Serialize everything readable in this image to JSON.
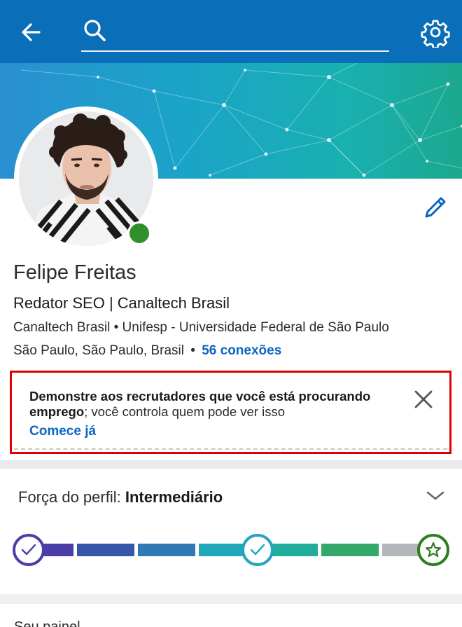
{
  "search": {
    "placeholder": "",
    "value": ""
  },
  "profile": {
    "name": "Felipe Freitas",
    "headline": "Redator SEO | Canaltech Brasil",
    "education_line": "Canaltech Brasil • Unifesp - Universidade Federal de São Paulo",
    "location": "São Paulo, São Paulo, Brasil",
    "separator": "•",
    "connections": "56 conexões",
    "presence": "online"
  },
  "job_card": {
    "bold_text": "Demonstre aos recrutadores que você está procurando emprego",
    "normal_text": "; você controla quem pode ver isso",
    "link": "Comece já"
  },
  "strength": {
    "label": "Força do perfil: ",
    "level": "Intermediário",
    "progress_steps": 2,
    "total_steps": 3
  },
  "next_section": {
    "title": "Seu painel"
  },
  "colors": {
    "topbar": "#0a6fb8",
    "link": "#0a66c2",
    "highlight_border": "#e00000",
    "presence": "#2f8f2a"
  },
  "icons": {
    "back": "arrow-left",
    "search": "magnifier",
    "settings": "gear",
    "edit": "pencil",
    "close": "x",
    "chevron": "chevron-down",
    "milestone_done": "check",
    "milestone_final": "star"
  }
}
